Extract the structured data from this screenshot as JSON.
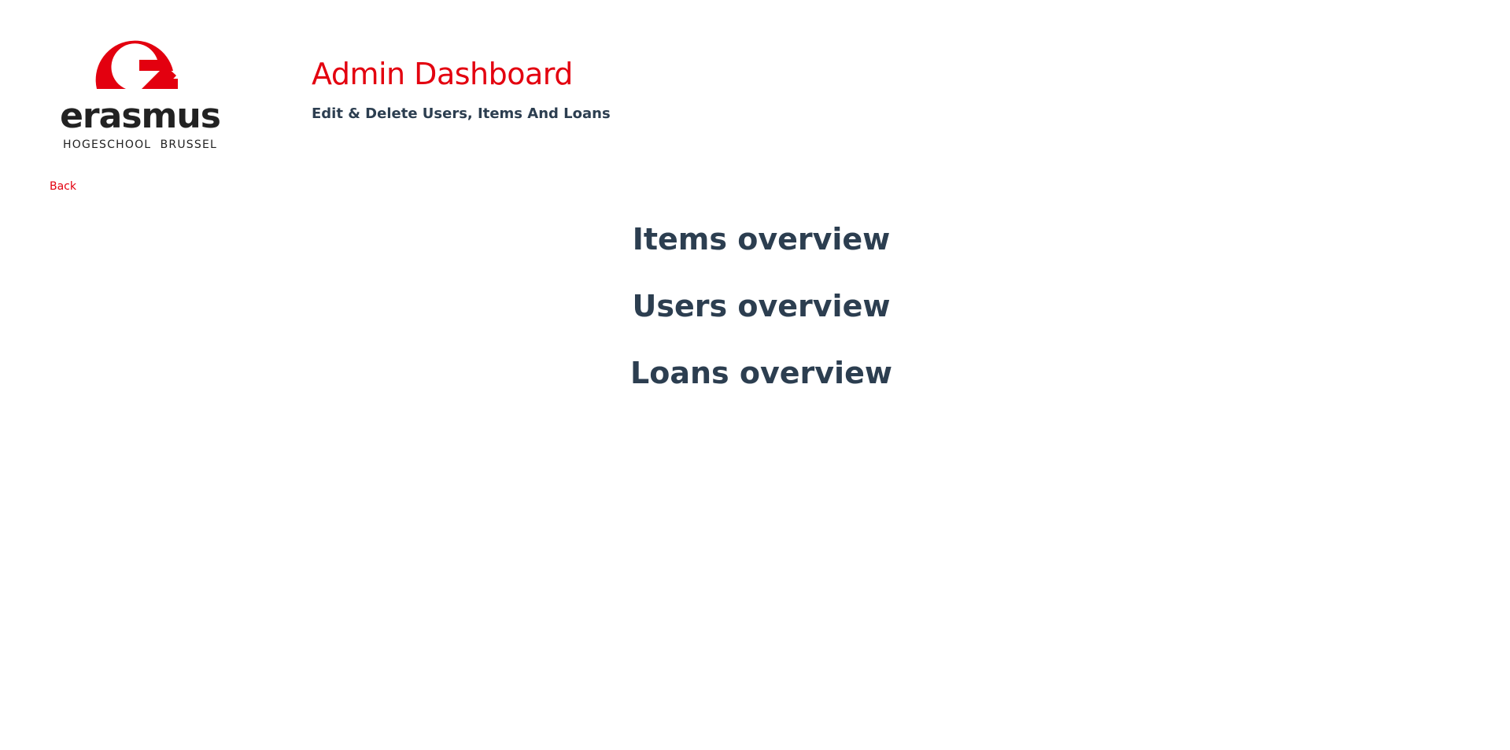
{
  "brand": {
    "logo_name": "erasmus",
    "logo_subtitle": "HOGESCHOOL  BRUSSEL",
    "accent_color": "#e3000f",
    "text_color": "#2c3e50"
  },
  "header": {
    "title": "Admin Dashboard",
    "subtitle": "Edit & Delete Users, Items And Loans"
  },
  "nav": {
    "back_label": "Back"
  },
  "overviews": [
    {
      "label": "Items overview"
    },
    {
      "label": "Users overview"
    },
    {
      "label": "Loans overview"
    }
  ]
}
